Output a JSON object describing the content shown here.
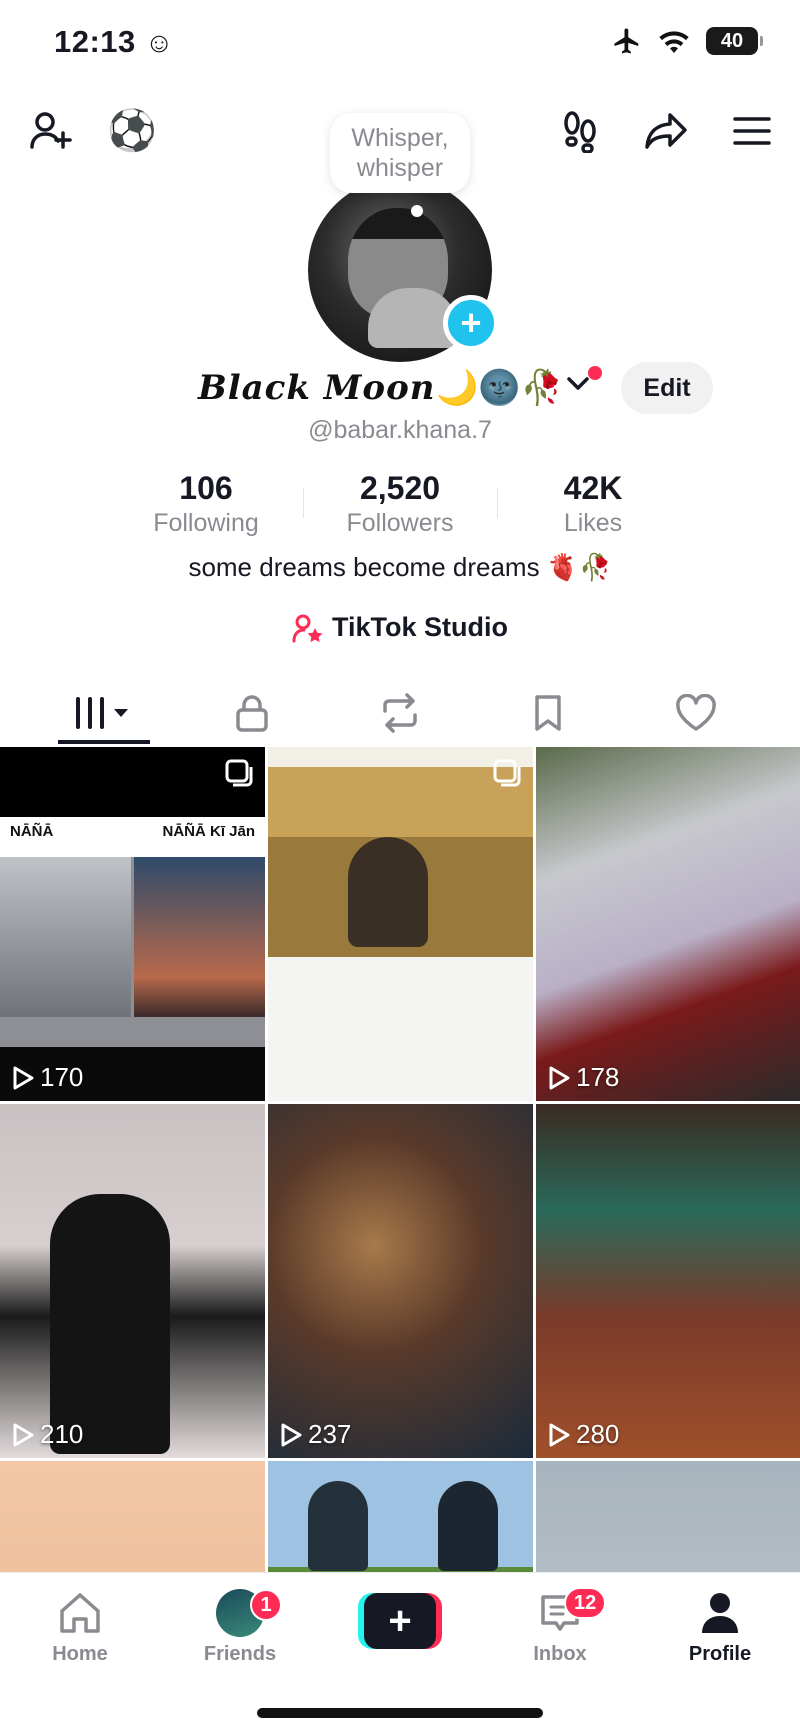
{
  "status_bar": {
    "time": "12:13",
    "battery": "40"
  },
  "bubble": {
    "line1": "Whisper,",
    "line2": "whisper"
  },
  "profile": {
    "display_name": "Black Moon",
    "name_emoji": "🌙🌚🥀",
    "username": "@babar.khana.7",
    "edit_label": "Edit",
    "bio": "some dreams become dreams 🫀🥀",
    "studio_label": "TikTok Studio"
  },
  "stats": [
    {
      "value": "106",
      "label": "Following"
    },
    {
      "value": "2,520",
      "label": "Followers"
    },
    {
      "value": "42K",
      "label": "Likes"
    }
  ],
  "tabs": [
    "videos-grid",
    "private",
    "reposts",
    "favorites",
    "liked"
  ],
  "grid": {
    "cell1": {
      "label_left": "NĀÑĀ",
      "label_right": "NĀÑĀ Kī Jān",
      "views": "170"
    },
    "cell2": {
      "views": ""
    },
    "cell3": {
      "views": "178"
    },
    "cell4": {
      "views": "210"
    },
    "cell5": {
      "views": "237"
    },
    "cell6": {
      "views": "280"
    }
  },
  "bottom_nav": {
    "home": "Home",
    "friends": "Friends",
    "friends_badge": "1",
    "inbox": "Inbox",
    "inbox_badge": "12",
    "profile": "Profile"
  },
  "colors": {
    "accent_red": "#fe2c55",
    "accent_cyan": "#25f4ee",
    "plus_blue": "#20c2ee"
  }
}
